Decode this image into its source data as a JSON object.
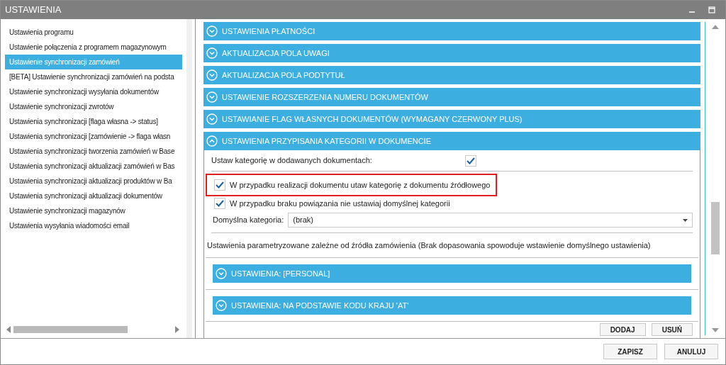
{
  "window": {
    "title": "USTAWIENIA"
  },
  "sidebar": {
    "items": [
      {
        "label": "Ustawienia programu",
        "selected": false
      },
      {
        "label": "Ustawienie połączenia z programem magazynowym",
        "selected": false
      },
      {
        "label": "Ustawienie synchronizacji zamówień",
        "selected": true
      },
      {
        "label": "[BETA] Ustawienie synchronizacji zamówień na podsta",
        "selected": false
      },
      {
        "label": "Ustawienie synchronizacji wysyłania dokumentów",
        "selected": false
      },
      {
        "label": "Ustawienie synchronizacji zwrotów",
        "selected": false
      },
      {
        "label": "Ustawienia synchronizacji [flaga własna -> status]",
        "selected": false
      },
      {
        "label": "Ustawienia synchronizacji [zamówienie -> flaga własn",
        "selected": false
      },
      {
        "label": "Ustawienia synchronizacji tworzenia zamówień w Base",
        "selected": false
      },
      {
        "label": "Ustawienia synchronizacji aktualizacji zamówień w Bas",
        "selected": false
      },
      {
        "label": "Ustawienia synchronizacji aktualizacji produktów w Ba",
        "selected": false
      },
      {
        "label": "Ustawienia synchronizacji aktualizacji dokumentów",
        "selected": false
      },
      {
        "label": "Ustawienie synchronizacji magazynów",
        "selected": false
      },
      {
        "label": "Ustawienia wysyłania wiadomości email",
        "selected": false
      }
    ]
  },
  "sections": [
    {
      "title": "USTAWIENIA PŁATNOŚCI",
      "expanded": false
    },
    {
      "title": "AKTUALIZACJA POLA UWAGI",
      "expanded": false
    },
    {
      "title": "AKTUALIZACJA POLA PODTYTUŁ",
      "expanded": false
    },
    {
      "title": "USTAWIENIE ROZSZERZENIA NUMERU DOKUMENTÓW",
      "expanded": false
    },
    {
      "title": "USTAWIANIE FLAG WŁASNYCH DOKUMENTÓW (WYMAGANY CZERWONY PLUS)",
      "expanded": false
    },
    {
      "title": "USTAWIENIA PRZYPISANIA KATEGORII W DOKUMENCIE",
      "expanded": true,
      "options": [
        {
          "kind": "label-left",
          "label": "Ustaw kategorię w dodawanych dokumentach:",
          "checked": true,
          "highlighted": false
        },
        {
          "kind": "label-right",
          "label": "W przypadku realizacji dokumentu utaw kategorię z dokumentu źródłowego",
          "checked": true,
          "highlighted": true
        },
        {
          "kind": "label-right",
          "label": "W przypadku braku powiązania nie ustawiaj domyślnej kategorii",
          "checked": true,
          "highlighted": false
        }
      ],
      "dropdown": {
        "label": "Domyślna kategoria:",
        "value": "(brak)"
      },
      "note": "Ustawienia parametryzowane zależne od źródła zamówienia (Brak dopasowania spowoduje wstawienie domyślnego ustawienia)",
      "subsections": [
        {
          "title": "USTAWIENIA: [PERSONAL]",
          "expanded": false
        },
        {
          "title": "USTAWIENIA: NA PODSTAWIE KODU KRAJU 'AT'",
          "expanded": false
        }
      ],
      "buttons": [
        "DODAJ",
        "USUŃ"
      ]
    }
  ],
  "footer": {
    "buttons": [
      "ZAPISZ",
      "ANULUJ"
    ]
  }
}
